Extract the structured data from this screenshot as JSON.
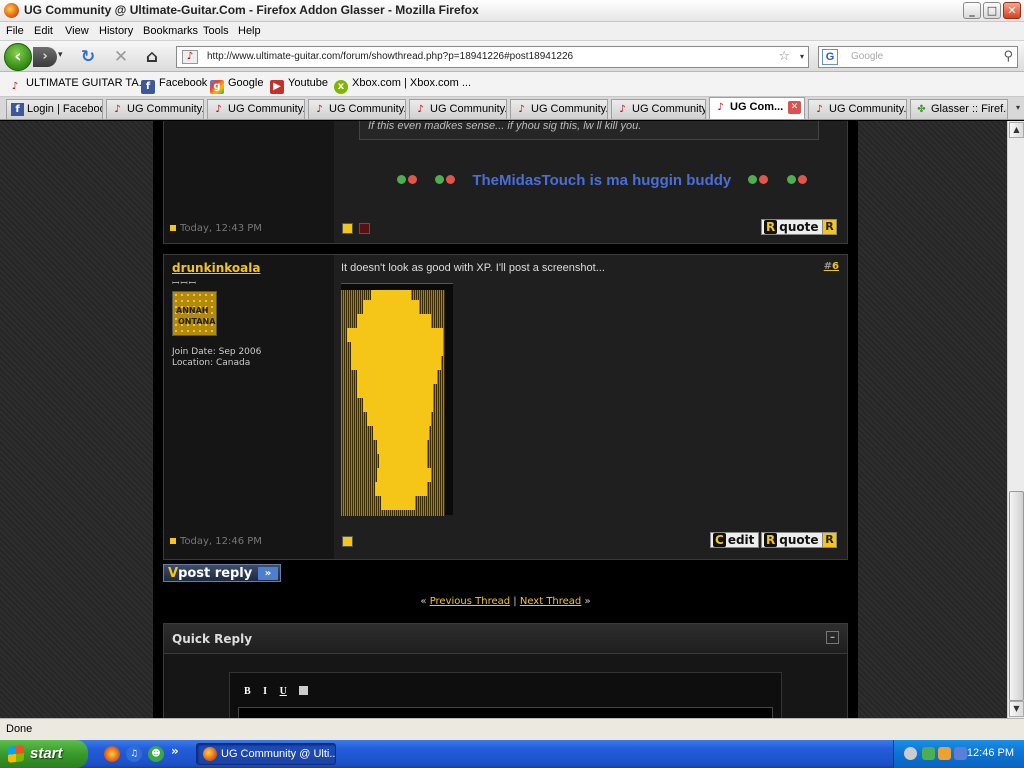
{
  "window": {
    "title": "UG Community @ Ultimate-Guitar.Com - Firefox Addon Glasser - Mozilla Firefox",
    "minimize": "_",
    "maximize": "□",
    "close": "✕"
  },
  "menu": [
    "File",
    "Edit",
    "View",
    "History",
    "Bookmarks",
    "Tools",
    "Help"
  ],
  "nav": {
    "back": "‹",
    "forward": "›",
    "reload": "↻",
    "stop": "✕",
    "home": "⌂",
    "url": "http://www.ultimate-guitar.com/forum/showthread.php?p=18941226#post18941226",
    "search_placeholder": "Google",
    "search_engine": "G"
  },
  "bookmarks": [
    {
      "label": "ULTIMATE GUITAR TA...",
      "icon": "guitar-icon"
    },
    {
      "label": "Facebook",
      "icon": "facebook-icon"
    },
    {
      "label": "Google",
      "icon": "google-icon"
    },
    {
      "label": "Youtube",
      "icon": "youtube-icon"
    },
    {
      "label": "Xbox.com | Xbox.com ...",
      "icon": "xbox-icon"
    }
  ],
  "tabs": [
    {
      "label": "Login | Facebook",
      "active": false
    },
    {
      "label": "UG Community...",
      "active": false
    },
    {
      "label": "UG Community...",
      "active": false
    },
    {
      "label": "UG Community...",
      "active": false
    },
    {
      "label": "UG Community...",
      "active": false
    },
    {
      "label": "UG Community...",
      "active": false
    },
    {
      "label": "UG Community...",
      "active": false
    },
    {
      "label": "UG Com...",
      "active": true
    },
    {
      "label": "UG Community...",
      "active": false
    },
    {
      "label": "Glasser :: Firef...",
      "active": false
    }
  ],
  "post_prev": {
    "quote_text": "If this even madkes sense... if yhou sig this, lw ll kill you.",
    "signature": "TheMidasTouch is ma huggin buddy",
    "date": "Today, 12:43 PM",
    "quote_btn": "quote"
  },
  "post": {
    "username": "drunkinkoala",
    "rank": "ꟷꟷꟷ",
    "avatar_text_1": "ANNAH",
    "avatar_text_2": "ONTANA",
    "join_date": "Join Date: Sep 2006",
    "location": "Location: Canada",
    "text": "It doesn't look as good with XP. I'll post a screenshot...",
    "number_hash": "#",
    "number": "6",
    "date": "Today, 12:46 PM",
    "edit_btn": "edit",
    "quote_btn": "quote"
  },
  "post_reply": {
    "label": "post reply",
    "arrow": "»"
  },
  "thread_nav": {
    "left": "«",
    "prev": "Previous Thread",
    "sep": "|",
    "next": "Next Thread",
    "right": "»"
  },
  "quick_reply": {
    "title": "Quick Reply",
    "tools": [
      "B",
      "I",
      "U"
    ]
  },
  "status": "Done",
  "taskbar": {
    "start": "start",
    "task": "UG Community @ Ulti...",
    "clock": "12:46 PM",
    "quicklaunch_more": "»"
  }
}
